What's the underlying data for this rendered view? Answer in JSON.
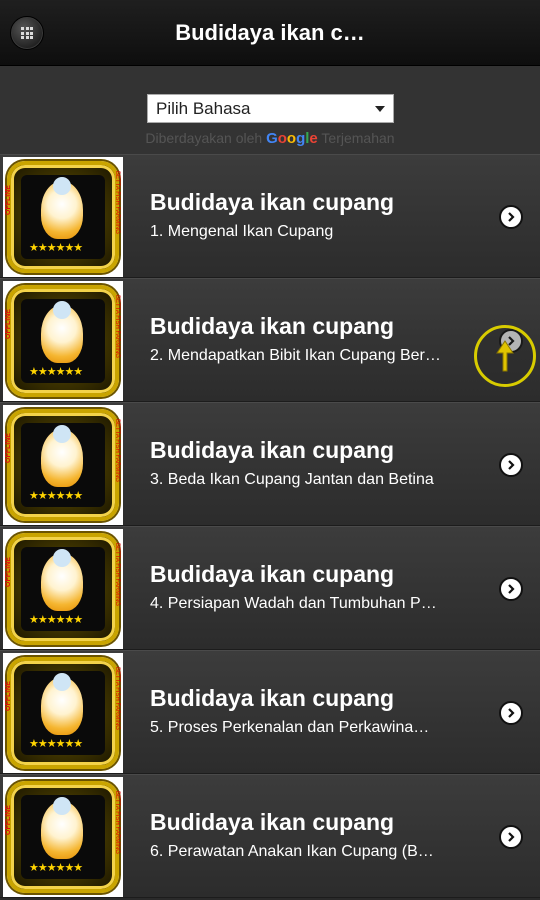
{
  "header": {
    "title": "Budidaya ikan c…",
    "menu_icon": "grid-icon"
  },
  "translate": {
    "select_value": "Pilih Bahasa",
    "powered_by": "Diberdayakan oleh",
    "google": "Google",
    "translate_word": "Terjemahan"
  },
  "items": [
    {
      "title": "Budidaya ikan cupang",
      "subtitle": "1. Mengenal Ikan Cupang"
    },
    {
      "title": "Budidaya ikan cupang",
      "subtitle": "2. Mendapatkan Bibit Ikan Cupang Ber…"
    },
    {
      "title": "Budidaya ikan cupang",
      "subtitle": "3. Beda Ikan Cupang Jantan dan Betina"
    },
    {
      "title": "Budidaya ikan cupang",
      "subtitle": "4. Persiapan Wadah dan Tumbuhan P…"
    },
    {
      "title": "Budidaya ikan cupang",
      "subtitle": "5. Proses Perkenalan dan Perkawina…"
    },
    {
      "title": "Budidaya ikan cupang",
      "subtitle": "6. Perawatan Anakan Ikan Cupang (B…"
    }
  ],
  "thumb": {
    "offline_tag": "OFFLINE",
    "side_tag": "BETTA FISH FARMING",
    "stars": "★★★★★★"
  },
  "colors": {
    "accent_gold": "#c9a400",
    "scroll_ring": "#d8cc00"
  }
}
